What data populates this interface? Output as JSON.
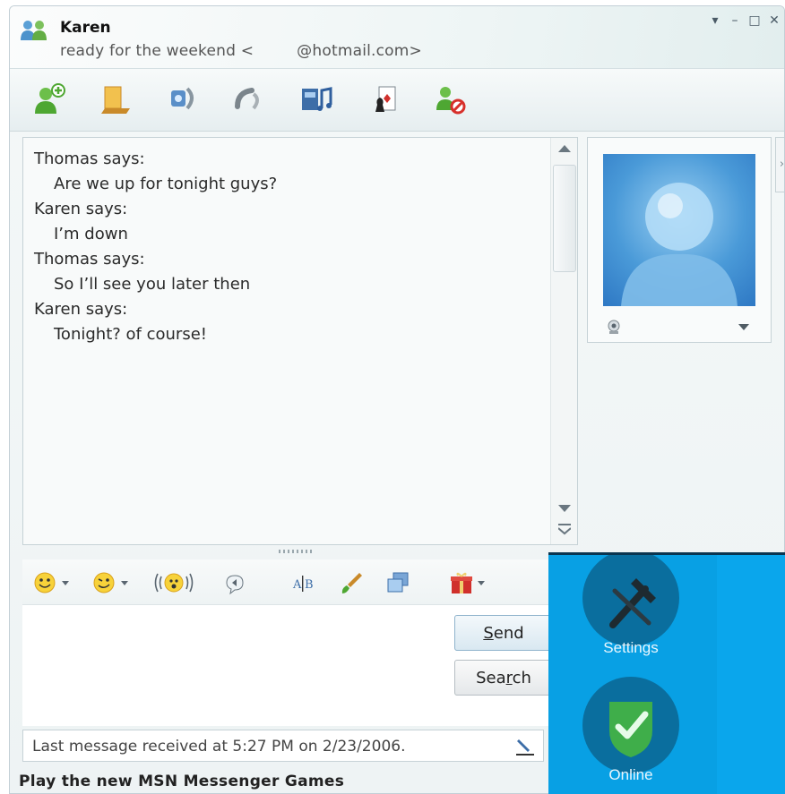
{
  "header": {
    "contact_name": "Karen",
    "status_text": "ready for the weekend <",
    "status_email": "@hotmail.com>",
    "window_controls": [
      "▾",
      "–",
      "□",
      "✕"
    ]
  },
  "toolbar": {
    "buttons": [
      {
        "icon": "invite-contact-icon"
      },
      {
        "icon": "send-files-icon"
      },
      {
        "icon": "webcam-call-icon"
      },
      {
        "icon": "voice-call-icon"
      },
      {
        "icon": "activities-icon"
      },
      {
        "icon": "games-icon"
      },
      {
        "icon": "block-contact-icon"
      }
    ]
  },
  "conversation": {
    "messages": [
      {
        "sender": "Thomas says:",
        "text": "Are we up for tonight guys?"
      },
      {
        "sender": "Karen says:",
        "text": "I’m down"
      },
      {
        "sender": "Thomas says:",
        "text": "So I’ll see you later then"
      },
      {
        "sender": "Karen says:",
        "text": "Tonight? of course!"
      }
    ]
  },
  "side_tab": {
    "label": "›"
  },
  "format_toolbar": {
    "items": [
      "emoticon-icon",
      "wink-icon",
      "nudge-icon",
      "voice-clip-icon",
      "font-icon",
      "background-icon",
      "window-icon",
      "gift-icon"
    ]
  },
  "buttons": {
    "send_label": "Send",
    "search_label": "Search"
  },
  "status_bar": {
    "text": "Last message received at 5:27 PM on 2/23/2006."
  },
  "ad": {
    "text": "Play the new MSN Messenger Games"
  },
  "overlay": {
    "settings_label": "Settings",
    "online_label": "Online",
    "colors": {
      "background": "#08a0e4",
      "circle": "#0a6e9e"
    }
  }
}
